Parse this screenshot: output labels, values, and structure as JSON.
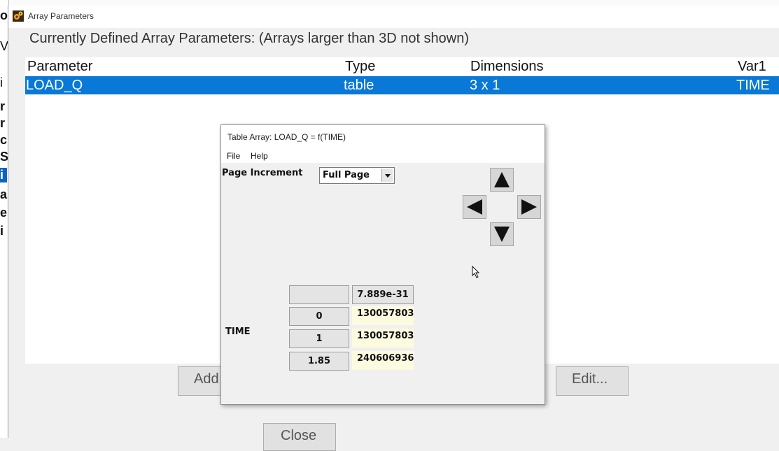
{
  "background": {
    "left_strip_chars": [
      "ol",
      "V",
      "i",
      "r",
      "r",
      "c",
      "Se",
      "i",
      "a",
      "e",
      "i"
    ]
  },
  "main_window": {
    "title": "Array Parameters",
    "defined_label": "Currently Defined Array Parameters: (Arrays larger than 3D not shown)",
    "columns": [
      "Parameter",
      "Type",
      "Dimensions",
      "Var1"
    ],
    "rows": [
      {
        "parameter": "LOAD_Q",
        "type": "table",
        "dimensions": "3 x 1",
        "var1": "TIME",
        "selected": true
      }
    ],
    "buttons": {
      "add": "Add",
      "edit": "Edit...",
      "close": "Close"
    },
    "selection_color": "#0a78d7"
  },
  "table_window": {
    "title": "Table Array: LOAD_Q = f(TIME)",
    "menu": [
      "File",
      "Help"
    ],
    "page_increment_label": "Page Increment",
    "page_increment_value": "Full Page",
    "column_header": "7.889e-31",
    "row_axis_label": "TIME",
    "rows": [
      {
        "index": "0",
        "value": "130057803"
      },
      {
        "index": "1",
        "value": "130057803"
      },
      {
        "index": "1.85",
        "value": "240606936"
      }
    ],
    "value_cell_color": "#fdfbdf"
  }
}
